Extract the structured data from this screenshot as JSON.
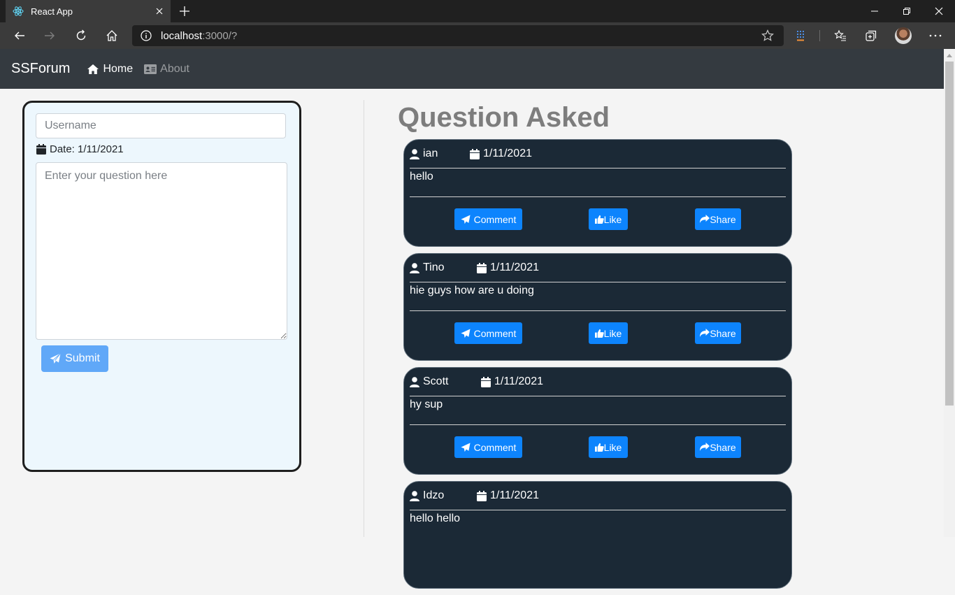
{
  "browser": {
    "tab_title": "React App",
    "url_host": "localhost",
    "url_rest": ":3000/?"
  },
  "app": {
    "brand": "SSForum",
    "nav": [
      {
        "label": "Home",
        "active": true,
        "icon": "home-icon"
      },
      {
        "label": "About",
        "active": false,
        "icon": "id-card-icon"
      }
    ]
  },
  "form": {
    "username_placeholder": "Username",
    "date_label": "Date: 1/11/2021",
    "question_placeholder": "Enter your question here",
    "submit_label": "Submit"
  },
  "questions": {
    "title": "Question Asked",
    "comment_label": "Comment",
    "like_label": "Like",
    "share_label": "Share",
    "items": [
      {
        "user": "ian",
        "date": "1/11/2021",
        "text": "hello"
      },
      {
        "user": "Tino",
        "date": "1/11/2021",
        "text": "hie guys how are u doing"
      },
      {
        "user": "Scott",
        "date": "1/11/2021",
        "text": "hy sup"
      },
      {
        "user": "Idzo",
        "date": "1/11/2021",
        "text": "hello hello"
      }
    ]
  },
  "colors": {
    "navbar": "#343a40",
    "card": "#1b2936",
    "primary_button": "#0d84fd",
    "submit_button": "#60a8f8",
    "form_panel": "#edf7fd"
  }
}
